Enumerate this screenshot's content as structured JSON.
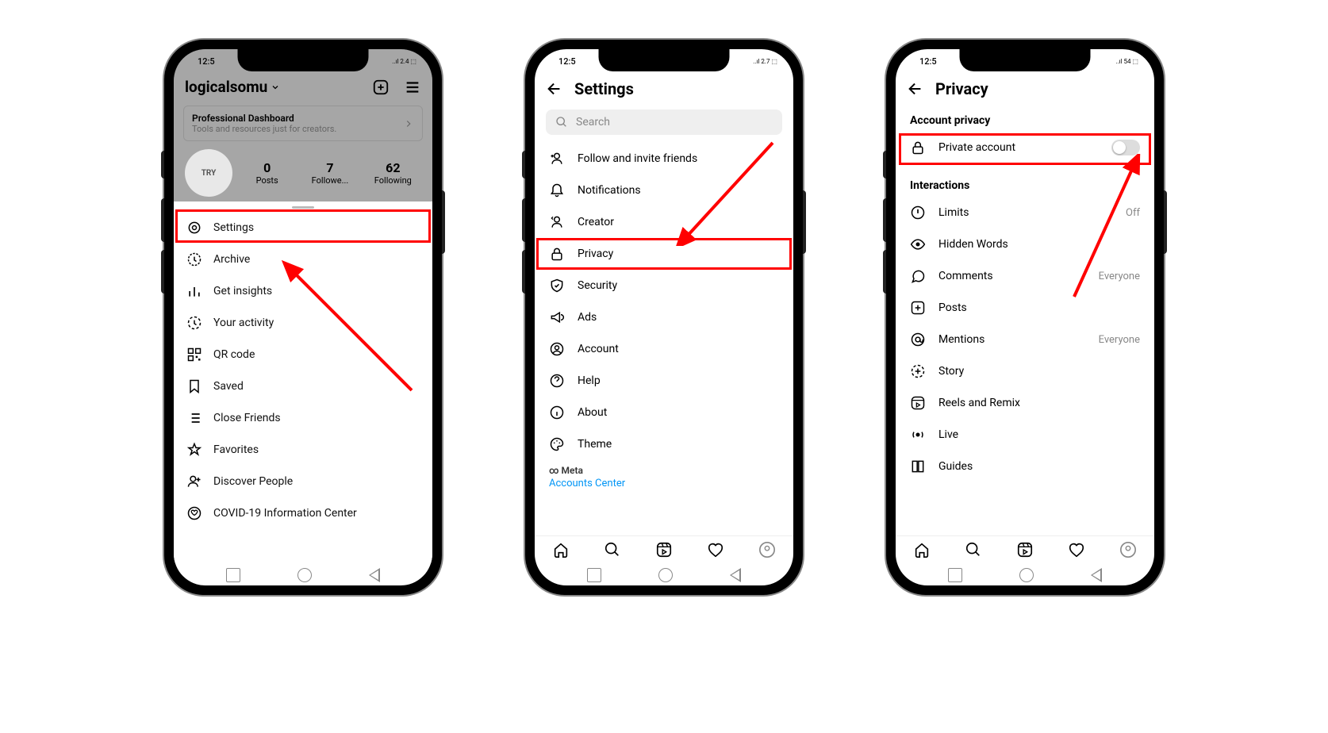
{
  "phone1": {
    "time": "12:5",
    "username": "logicalsomu",
    "dashboard": {
      "title": "Professional Dashboard",
      "subtitle": "Tools and resources just for creators."
    },
    "avatar_text": "TRY",
    "stats": [
      {
        "num": "0",
        "label": "Posts"
      },
      {
        "num": "7",
        "label": "Followe..."
      },
      {
        "num": "62",
        "label": "Following"
      }
    ],
    "menu": [
      "Settings",
      "Archive",
      "Get insights",
      "Your activity",
      "QR code",
      "Saved",
      "Close Friends",
      "Favorites",
      "Discover People",
      "COVID-19 Information Center"
    ]
  },
  "phone2": {
    "time": "12:5",
    "title": "Settings",
    "search_placeholder": "Search",
    "items": [
      "Follow and invite friends",
      "Notifications",
      "Creator",
      "Privacy",
      "Security",
      "Ads",
      "Account",
      "Help",
      "About",
      "Theme"
    ],
    "meta_brand": "Meta",
    "meta_link": "Accounts Center"
  },
  "phone3": {
    "time": "12:5",
    "title": "Privacy",
    "section1": "Account privacy",
    "private_label": "Private account",
    "section2": "Interactions",
    "items": [
      {
        "label": "Limits",
        "value": "Off"
      },
      {
        "label": "Hidden Words",
        "value": ""
      },
      {
        "label": "Comments",
        "value": "Everyone"
      },
      {
        "label": "Posts",
        "value": ""
      },
      {
        "label": "Mentions",
        "value": "Everyone"
      },
      {
        "label": "Story",
        "value": ""
      },
      {
        "label": "Reels and Remix",
        "value": ""
      },
      {
        "label": "Live",
        "value": ""
      },
      {
        "label": "Guides",
        "value": ""
      }
    ]
  }
}
